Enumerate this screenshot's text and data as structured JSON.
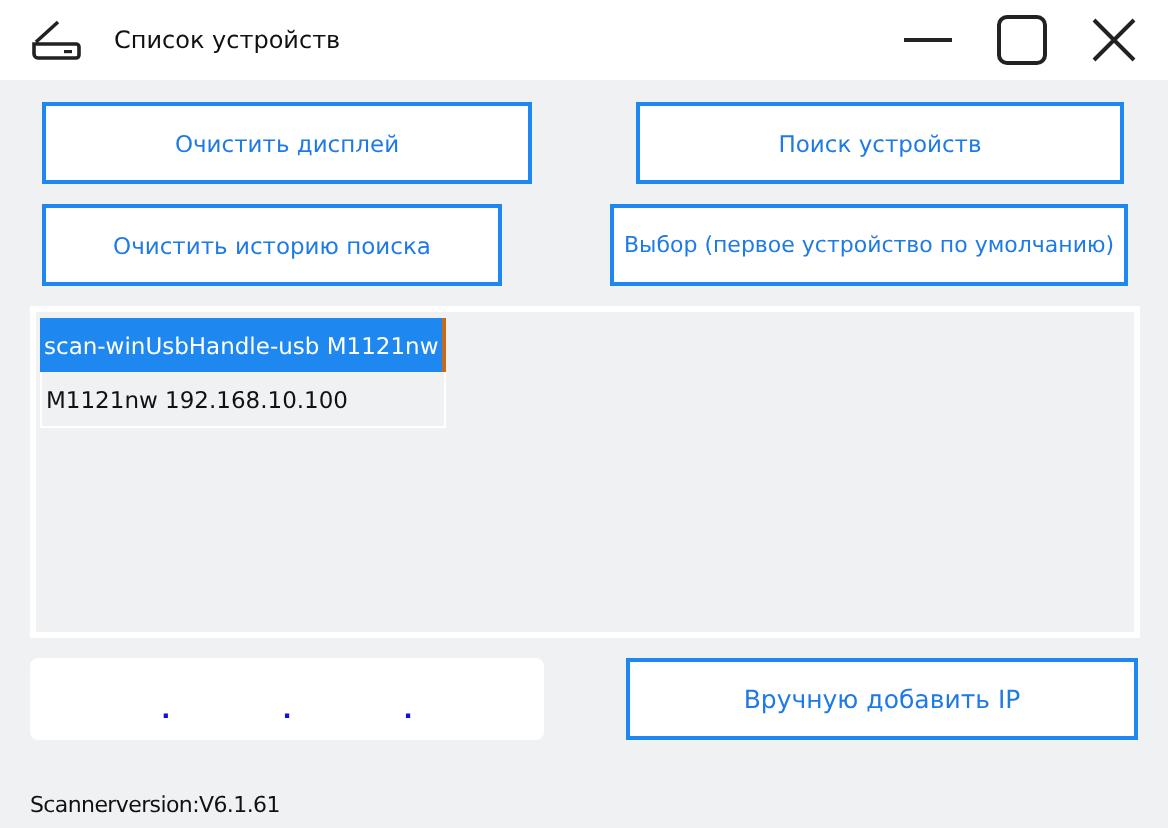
{
  "window": {
    "title": "Список устройств"
  },
  "buttons": [
    {
      "label": "Очистить дисплей"
    },
    {
      "label": "Поиск устройств"
    },
    {
      "label": "Очистить историю поиска"
    },
    {
      "label": "Выбор (первое устройство по умолчанию)"
    }
  ],
  "devices": [
    {
      "label": "scan-winUsbHandle-usb M1121nw",
      "selected": true
    },
    {
      "label": "M1121nw 192.168.10.100",
      "selected": false
    }
  ],
  "ip_field": {
    "separators": [
      ".",
      ".",
      "."
    ]
  },
  "add_ip_button": {
    "label": "Вручную добавить IP"
  },
  "status": "Scannerversion:V6.1.61"
}
